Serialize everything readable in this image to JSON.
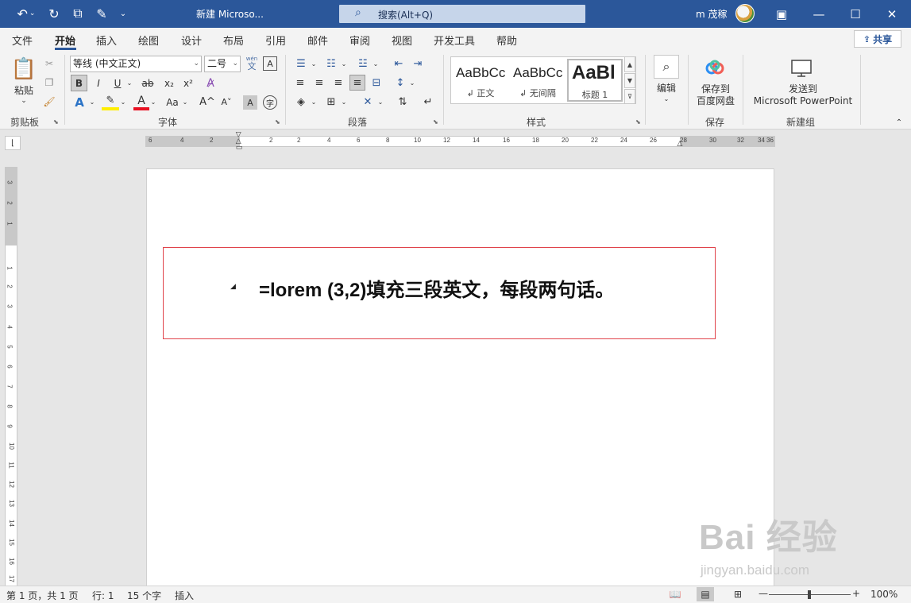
{
  "titlebar": {
    "document_title": "新建 Microso...",
    "search_text": "搜索(Alt+Q)",
    "user_name": "m 茂稼",
    "icons": [
      "undo-icon",
      "redo-icon",
      "touch-mode-icon",
      "edit-icon",
      "customize-icon",
      "search-icon",
      "ribbon-display-icon",
      "minimize-icon",
      "maximize-icon",
      "close-icon"
    ]
  },
  "tabs": [
    "文件",
    "开始",
    "插入",
    "绘图",
    "设计",
    "布局",
    "引用",
    "邮件",
    "审阅",
    "视图",
    "开发工具",
    "帮助"
  ],
  "share_label": "共享",
  "ribbon": {
    "clipboard": {
      "paste_label": "粘贴",
      "group_label": "剪贴板"
    },
    "font": {
      "font_name": "等线 (中文正文)",
      "font_size": "二号",
      "group_label": "字体",
      "format_buttons": [
        "B",
        "I",
        "U",
        "ab",
        "x₂",
        "x²"
      ],
      "wen_label": "wén",
      "wen_char": "文",
      "case_label": "Aa",
      "grow_label": "A^",
      "shrink_label": "A˅"
    },
    "paragraph": {
      "group_label": "段落"
    },
    "styles": {
      "group_label": "样式",
      "items": [
        {
          "sample": "AaBbCc",
          "name": "↲ 正文"
        },
        {
          "sample": "AaBbCc",
          "name": "↲ 无间隔"
        },
        {
          "sample": "AaBl",
          "name": "标题 1"
        }
      ]
    },
    "editing": {
      "label": "编辑"
    },
    "save": {
      "line1": "保存到",
      "line2": "百度网盘",
      "group_label": "保存"
    },
    "newgroup": {
      "line1": "发送到",
      "line2": "Microsoft PowerPoint",
      "group_label": "新建组"
    }
  },
  "ruler": {
    "h_numbers": [
      "6",
      "4",
      "2",
      "2",
      "2",
      "4",
      "6",
      "8",
      "10",
      "12",
      "14",
      "16",
      "18",
      "20",
      "22",
      "24",
      "26",
      "28",
      "30",
      "32",
      "34",
      "36"
    ],
    "v_numbers": [
      "3",
      "2",
      "1",
      "1",
      "2",
      "3",
      "4",
      "5",
      "6",
      "7",
      "8",
      "9",
      "10",
      "11",
      "12",
      "13",
      "14",
      "15",
      "16",
      "17"
    ]
  },
  "document": {
    "formula": "=lorem (3,2)填充三段英文，每段两句话。"
  },
  "watermark": {
    "brand": "Bai 经验",
    "url": "jingyan.baidu.com"
  },
  "statusbar": {
    "page": "第 1 页，共 1 页",
    "line": "行: 1",
    "words": "15 个字",
    "mode": "插入",
    "zoom": "100%",
    "zoom_level_fraction": 0.5
  },
  "colors": {
    "title_bar": "#2b579a",
    "highlight_red": "#e0434b",
    "page_bg": "#ffffff"
  }
}
